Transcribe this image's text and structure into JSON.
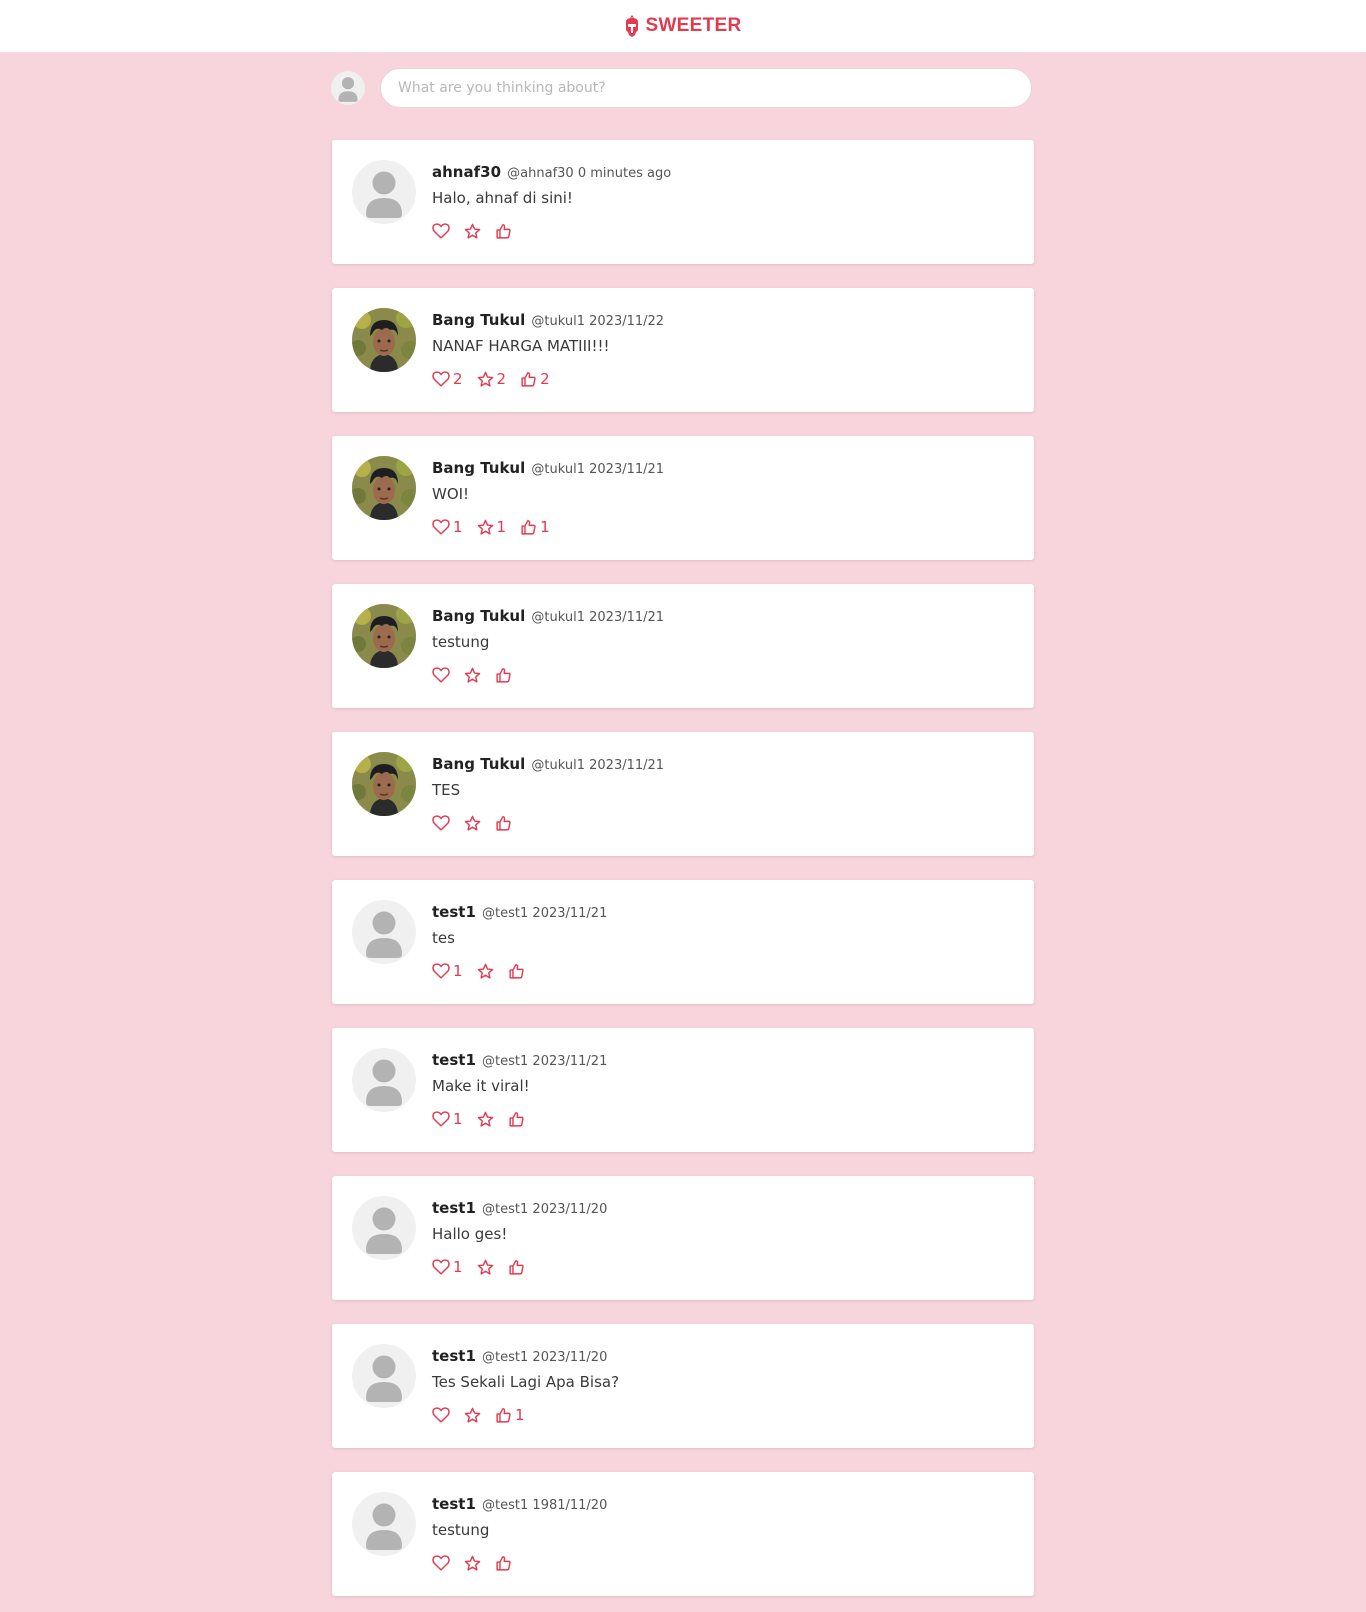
{
  "brand": {
    "name": "SWEETER",
    "icon": "helmet-icon",
    "color": "#e23a4f"
  },
  "composer": {
    "placeholder": "What are you thinking about?"
  },
  "colors": {
    "background": "#f8d4dc",
    "accent": "#e23a4f",
    "card": "#ffffff"
  },
  "posts": [
    {
      "name": "ahnaf30",
      "handle": "@ahnaf30",
      "time": "0 minutes ago",
      "text": "Halo, ahnaf di sini!",
      "avatar": "default",
      "likes": "",
      "stars": "",
      "thumbs": ""
    },
    {
      "name": "Bang Tukul",
      "handle": "@tukul1",
      "time": "2023/11/22",
      "text": "NANAF HARGA MATIII!!!",
      "avatar": "photo",
      "likes": "2",
      "stars": "2",
      "thumbs": "2"
    },
    {
      "name": "Bang Tukul",
      "handle": "@tukul1",
      "time": "2023/11/21",
      "text": "WOI!",
      "avatar": "photo",
      "likes": "1",
      "stars": "1",
      "thumbs": "1"
    },
    {
      "name": "Bang Tukul",
      "handle": "@tukul1",
      "time": "2023/11/21",
      "text": "testung",
      "avatar": "photo",
      "likes": "",
      "stars": "",
      "thumbs": ""
    },
    {
      "name": "Bang Tukul",
      "handle": "@tukul1",
      "time": "2023/11/21",
      "text": "TES",
      "avatar": "photo",
      "likes": "",
      "stars": "",
      "thumbs": ""
    },
    {
      "name": "test1",
      "handle": "@test1",
      "time": "2023/11/21",
      "text": "tes",
      "avatar": "default",
      "likes": "1",
      "stars": "",
      "thumbs": ""
    },
    {
      "name": "test1",
      "handle": "@test1",
      "time": "2023/11/21",
      "text": "Make it viral!",
      "avatar": "default",
      "likes": "1",
      "stars": "",
      "thumbs": ""
    },
    {
      "name": "test1",
      "handle": "@test1",
      "time": "2023/11/20",
      "text": "Hallo ges!",
      "avatar": "default",
      "likes": "1",
      "stars": "",
      "thumbs": ""
    },
    {
      "name": "test1",
      "handle": "@test1",
      "time": "2023/11/20",
      "text": "Tes Sekali Lagi Apa Bisa?",
      "avatar": "default",
      "likes": "",
      "stars": "",
      "thumbs": "1"
    },
    {
      "name": "test1",
      "handle": "@test1",
      "time": "1981/11/20",
      "text": "testung",
      "avatar": "default",
      "likes": "",
      "stars": "",
      "thumbs": ""
    }
  ]
}
